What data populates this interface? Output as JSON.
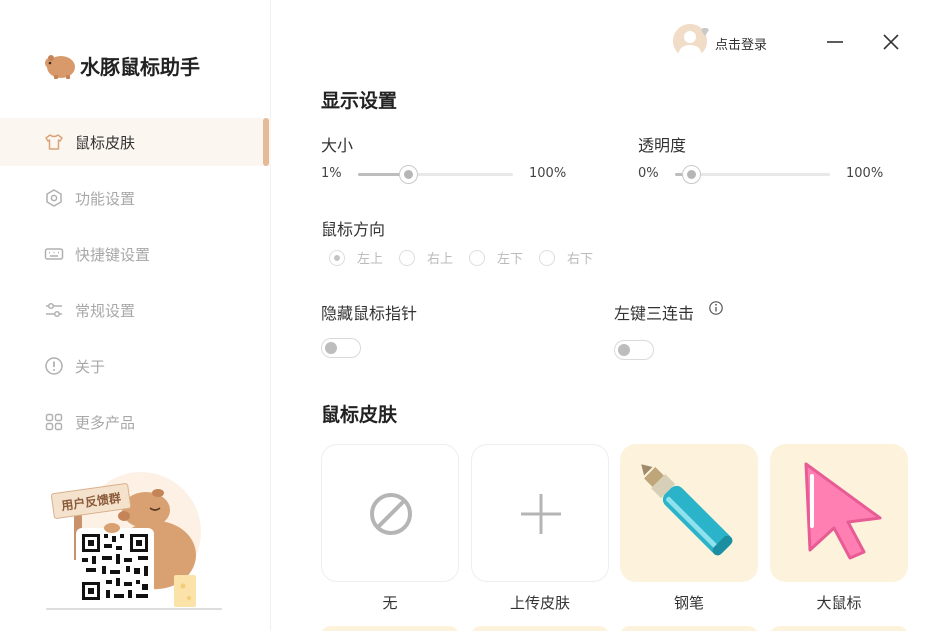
{
  "app": {
    "name": "水豚鼠标助手"
  },
  "sidebar": {
    "items": [
      {
        "label": "鼠标皮肤",
        "icon": "tshirt-icon",
        "active": true
      },
      {
        "label": "功能设置",
        "icon": "hexagon-gear-icon",
        "active": false
      },
      {
        "label": "快捷键设置",
        "icon": "keyboard-icon",
        "active": false
      },
      {
        "label": "常规设置",
        "icon": "sliders-icon",
        "active": false
      },
      {
        "label": "关于",
        "icon": "info-circle-icon",
        "active": false
      },
      {
        "label": "更多产品",
        "icon": "grid-icon",
        "active": false
      }
    ],
    "promo": {
      "sign": "用户反馈群"
    }
  },
  "header": {
    "login": "点击登录"
  },
  "display": {
    "title": "显示设置",
    "size": {
      "label": "大小",
      "min": "1%",
      "max": "100%",
      "value": 0.3
    },
    "opacity": {
      "label": "透明度",
      "min": "0%",
      "max": "100%",
      "value": 0.05
    },
    "direction": {
      "label": "鼠标方向",
      "options": [
        "左上",
        "右上",
        "左下",
        "右下"
      ],
      "selected": "左上"
    },
    "hide_pointer": {
      "label": "隐藏鼠标指针",
      "on": false
    },
    "triple_click": {
      "label": "左键三连击",
      "on": false
    }
  },
  "skins": {
    "title": "鼠标皮肤",
    "items": [
      {
        "name": "无",
        "icon": "none-icon"
      },
      {
        "name": "上传皮肤",
        "icon": "plus-icon"
      },
      {
        "name": "钢笔",
        "icon": "pen-icon"
      },
      {
        "name": "大鼠标",
        "icon": "big-cursor-icon"
      }
    ]
  },
  "colors": {
    "accent": "#e3bb99",
    "active_bg": "#fcf6f1",
    "skin_bg": "#fdf3dc"
  }
}
